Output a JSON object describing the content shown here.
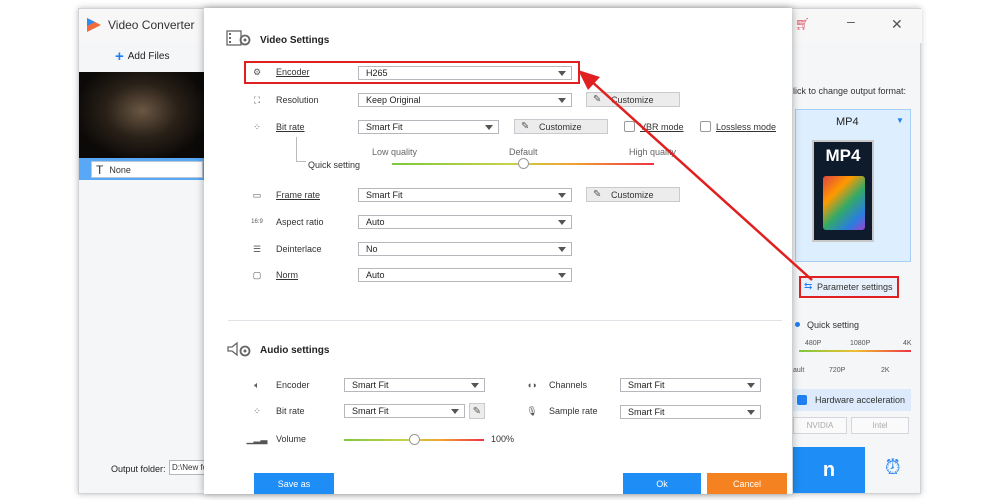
{
  "app": {
    "title": "Video Converter",
    "add_files": "Add Files",
    "file_title_option": "None",
    "output_folder_label": "Output folder:",
    "output_folder_value": "D:\\New fo"
  },
  "right_panel": {
    "click_hint": "lick to change output format:",
    "format_name": "MP4",
    "format_badge": "MP4",
    "parameter_settings": "Parameter settings",
    "quick_setting": "Quick setting",
    "ticks_top": [
      "480P",
      "1080P",
      "4K"
    ],
    "ticks_bottom": [
      "ault",
      "720P",
      "2K"
    ],
    "hardware_acceleration": "Hardware acceleration",
    "nvidia": "NVIDIA",
    "intel": "Intel",
    "run_label": "n"
  },
  "video": {
    "title": "Video Settings",
    "encoder": {
      "label": "Encoder",
      "value": "H265"
    },
    "resolution": {
      "label": "Resolution",
      "value": "Keep Original",
      "customize": "Customize"
    },
    "bitrate": {
      "label": "Bit rate",
      "value": "Smart Fit",
      "customize": "Customize",
      "vbr": "VBR mode",
      "lossless": "Lossless mode"
    },
    "quick_setting": {
      "label": "Quick setting",
      "low": "Low quality",
      "default": "Default",
      "high": "High quality",
      "level": 0.5
    },
    "frame_rate": {
      "label": "Frame rate",
      "value": "Smart Fit",
      "customize": "Customize"
    },
    "aspect_ratio": {
      "label": "Aspect ratio",
      "value": "Auto",
      "icon_text": "16:9"
    },
    "deinterlace": {
      "label": "Deinterlace",
      "value": "No"
    },
    "norm": {
      "label": "Norm",
      "value": "Auto"
    }
  },
  "audio": {
    "title": "Audio settings",
    "encoder": {
      "label": "Encoder",
      "value": "Smart Fit"
    },
    "bitrate": {
      "label": "Bit rate",
      "value": "Smart Fit"
    },
    "channels": {
      "label": "Channels",
      "value": "Smart Fit"
    },
    "sample_rate": {
      "label": "Sample rate",
      "value": "Smart Fit"
    },
    "volume": {
      "label": "Volume",
      "value": "100%",
      "level": 0.5
    }
  },
  "buttons": {
    "save_as": "Save as",
    "ok": "Ok",
    "cancel": "Cancel"
  },
  "colors": {
    "accent": "#1e8df5",
    "annotation": "#e02020",
    "cancel": "#f58220"
  }
}
